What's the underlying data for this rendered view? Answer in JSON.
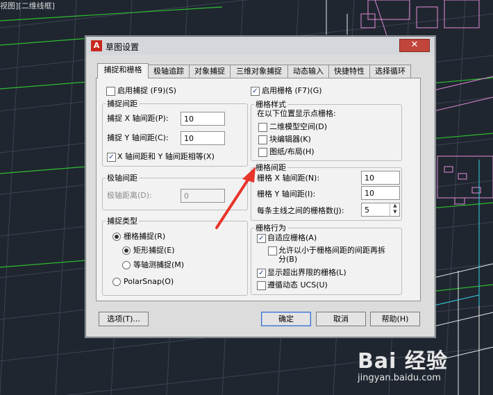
{
  "topbar": {
    "text": "视图][二维线框]"
  },
  "watermark": {
    "logo": "Bai 经验",
    "url": "jingyan.baidu.com"
  },
  "dialog": {
    "title": "草图设置",
    "icon_letter": "A",
    "close_label": "✕",
    "tabs": [
      "捕捉和栅格",
      "极轴追踪",
      "对象捕捉",
      "三维对象捕捉",
      "动态输入",
      "快捷特性",
      "选择循环"
    ],
    "snap": {
      "enable_label": "启用捕捉 (F9)(S)",
      "enabled": false,
      "spacing_title": "捕捉间距",
      "x_label": "捕捉 X 轴间距(P):",
      "x_value": "10",
      "y_label": "捕捉 Y 轴间距(C):",
      "y_value": "10",
      "equal_label": "X 轴间距和 Y 轴间距相等(X)",
      "equal_checked": true
    },
    "polar": {
      "title": "极轴间距",
      "distance_label": "极轴距离(D):",
      "distance_value": "0"
    },
    "snap_type": {
      "title": "捕捉类型",
      "grid_snap": "栅格捕捉(R)",
      "rect_snap": "矩形捕捉(E)",
      "iso_snap": "等轴测捕捉(M)",
      "polar_snap": "PolarSnap(O)",
      "selected": "grid_snap",
      "sub_selected": "rect_snap"
    },
    "grid": {
      "enable_label": "启用栅格 (F7)(G)",
      "enabled": true,
      "style_title": "栅格样式",
      "style_desc": "在以下位置显示点栅格:",
      "style_2d": "二维模型空间(D)",
      "style_block": "块编辑器(K)",
      "style_sheet": "图纸/布局(H)",
      "spacing_title": "栅格间距",
      "x_label": "栅格 X 轴间距(N):",
      "x_value": "10",
      "y_label": "栅格 Y 轴间距(I):",
      "y_value": "10",
      "major_label": "每条主线之间的栅格数(J):",
      "major_value": "5"
    },
    "grid_behavior": {
      "title": "栅格行为",
      "adaptive_label": "自适应栅格(A)",
      "adaptive_checked": true,
      "subdivide_label_1": "允许以小于栅格间距的间距再拆",
      "subdivide_label_2": "分(B)",
      "subdivide_checked": false,
      "beyond_label": "显示超出界限的栅格(L)",
      "beyond_checked": true,
      "follow_label": "遵循动态 UCS(U)",
      "follow_checked": false
    },
    "buttons": {
      "options": "选项(T)...",
      "ok": "确定",
      "cancel": "取消",
      "help": "帮助(H)"
    }
  },
  "colors": {
    "background": "#1f2630",
    "arrow": "#e8342a",
    "dialog": "#dcdcdc",
    "panel": "#f2f2f2",
    "close_button": "#c1453a"
  }
}
